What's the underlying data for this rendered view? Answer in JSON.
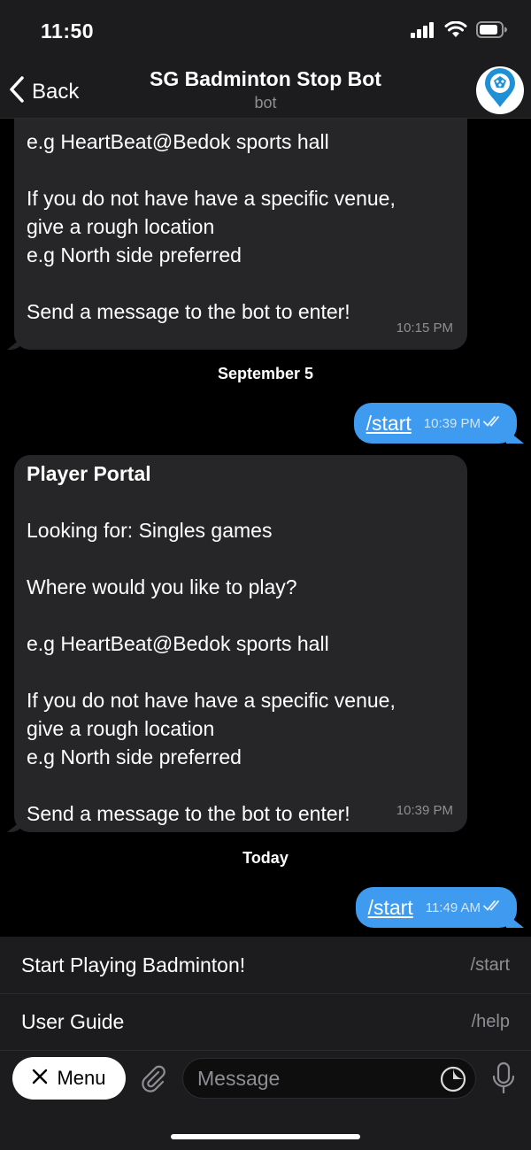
{
  "status_bar": {
    "time": "11:50"
  },
  "header": {
    "back_label": "Back",
    "title": "SG Badminton Stop Bot",
    "subtitle": "bot"
  },
  "messages": [
    {
      "lines": [
        "e.g HeartBeat@Bedok sports hall",
        "",
        "If you do not have have a specific venue,",
        "give a rough location",
        "e.g North side preferred",
        "",
        "Send a message to the bot to enter!"
      ],
      "time": "10:15 PM"
    },
    {
      "date": "September 5"
    },
    {
      "command": "/start",
      "time": "10:39 PM"
    },
    {
      "title": "Player Portal",
      "lines": [
        "Looking for: Singles games",
        "",
        "Where would you like to play?",
        "",
        "e.g HeartBeat@Bedok sports hall",
        "",
        "If you do not have have a specific venue,",
        "give a rough location",
        "e.g North side preferred",
        "",
        "Send a message to the bot to enter!"
      ],
      "time": "10:39 PM"
    },
    {
      "date": "Today"
    },
    {
      "command": "/start",
      "time": "11:49 AM"
    }
  ],
  "commands": [
    {
      "description": "Start Playing Badminton!",
      "command": "/start"
    },
    {
      "description": "User Guide",
      "command": "/help"
    }
  ],
  "input": {
    "menu_label": "Menu",
    "placeholder": "Message"
  },
  "colors": {
    "outgoing_bubble": "#3f9bf0",
    "incoming_bubble": "#262628",
    "bar_background": "#1c1c1e"
  }
}
